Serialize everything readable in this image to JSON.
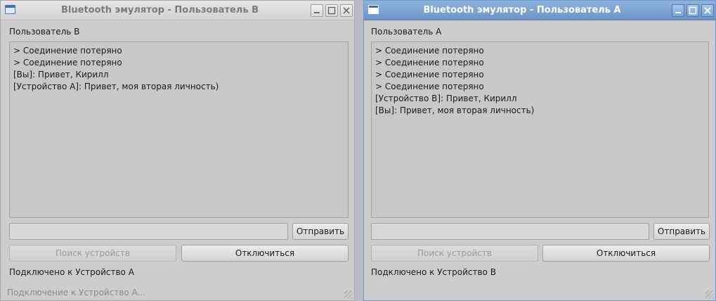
{
  "window_b": {
    "title": "Bluetooth эмулятор - Пользователь B",
    "user_label": "Пользователь B",
    "log": [
      "> Соединение потеряно",
      "> Соединение потеряно",
      "[Вы]: Привет, Кирилл",
      "[Устройство A]: Привет, моя вторая личность)"
    ],
    "message_input": "",
    "send_label": "Отправить",
    "search_label": "Поиск устройств",
    "disconnect_label": "Отключиться",
    "status": "Подключено к Устройство A",
    "statusbar": "Подключение к Устройство A..."
  },
  "window_a": {
    "title": "Bluetooth эмулятор - Пользователь A",
    "user_label": "Пользователь A",
    "log": [
      "> Соединение потеряно",
      "> Соединение потеряно",
      "> Соединение потеряно",
      "> Соединение потеряно",
      "[Устройство B]: Привет, Кирилл",
      "[Вы]: Привет, моя вторая личность)"
    ],
    "message_input": "",
    "send_label": "Отправить",
    "search_label": "Поиск устройств",
    "disconnect_label": "Отключиться",
    "status": "Подключено к Устройство B"
  },
  "icons": {
    "app": "app-window-icon",
    "minimize": "minimize-icon",
    "maximize": "maximize-icon",
    "close": "close-icon"
  },
  "colors": {
    "active_titlebar": "#7aa1d4",
    "inactive_titlebar": "#dcdcdc",
    "window_bg": "#cdcdcd"
  }
}
